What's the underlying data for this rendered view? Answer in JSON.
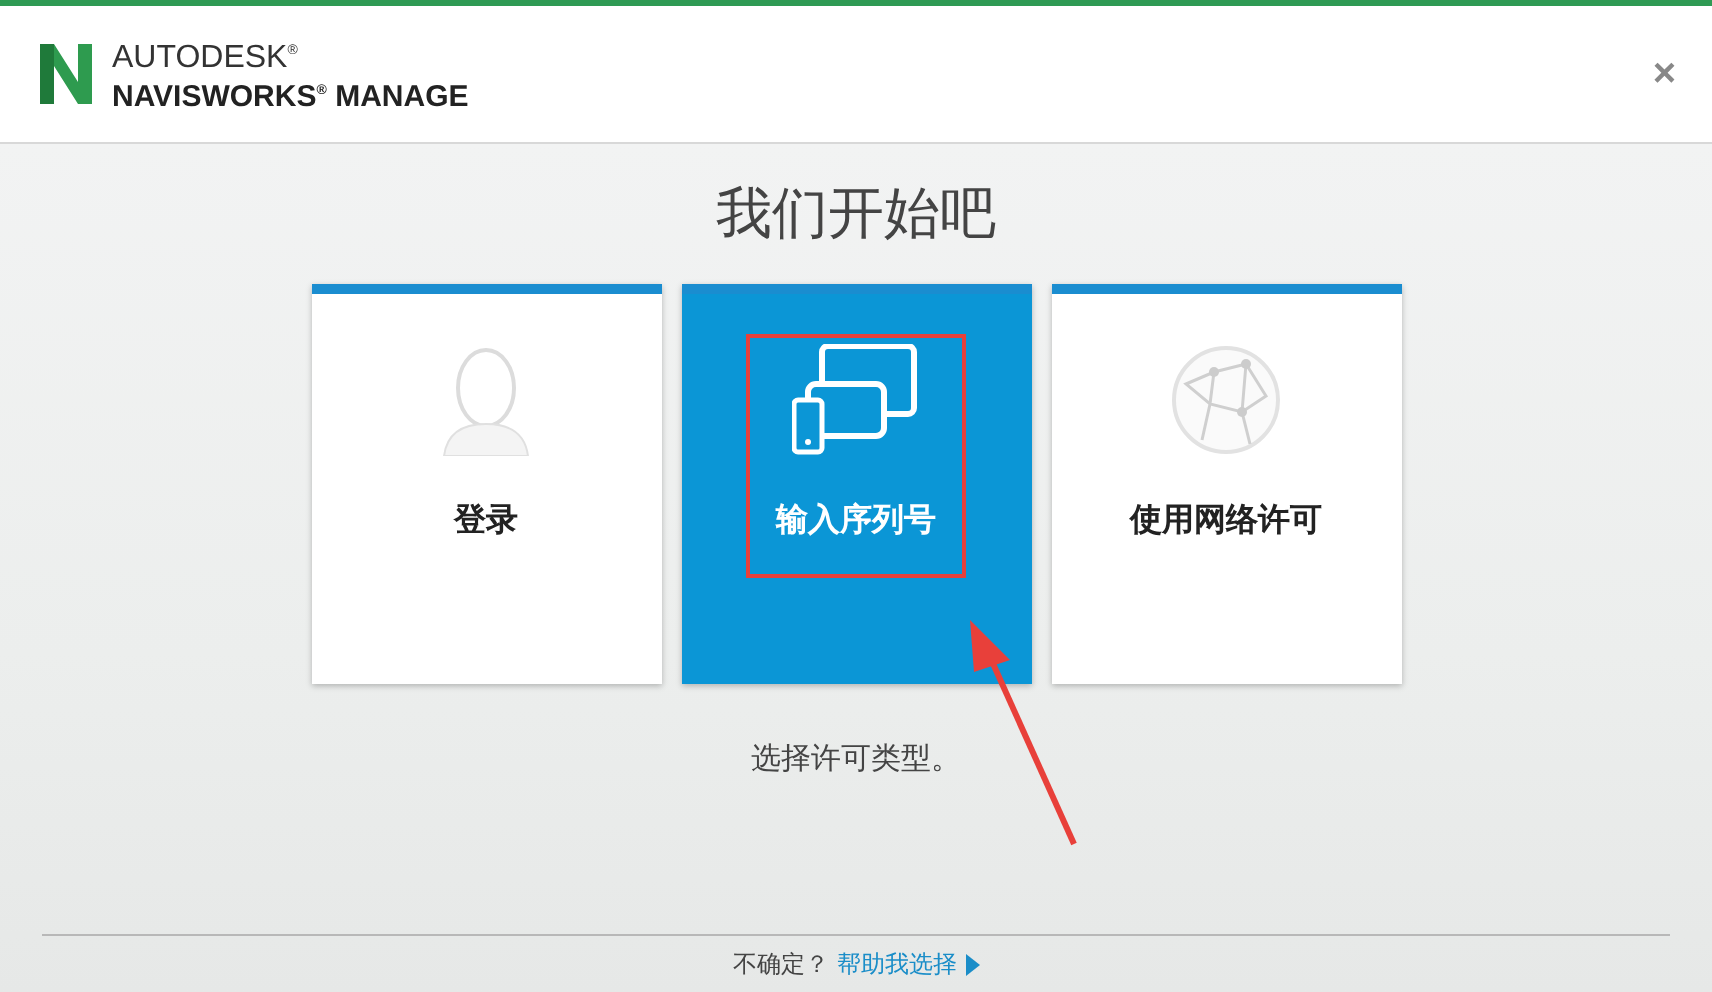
{
  "header": {
    "brand": "AUTODESK",
    "brand_mark": "®",
    "product": "NAVISWORKS",
    "product_mark": "®",
    "edition": "MANAGE",
    "close": "×"
  },
  "title": "我们开始吧",
  "cards": [
    {
      "kind": "signin",
      "label": "登录",
      "selected": false,
      "highlighted": false
    },
    {
      "kind": "serial",
      "label": "输入序列号",
      "selected": true,
      "highlighted": true
    },
    {
      "kind": "network",
      "label": "使用网络许可",
      "selected": false,
      "highlighted": false
    }
  ],
  "instruction": "选择许可类型。",
  "footer": {
    "question": "不确定？",
    "link": "帮助我选择"
  }
}
